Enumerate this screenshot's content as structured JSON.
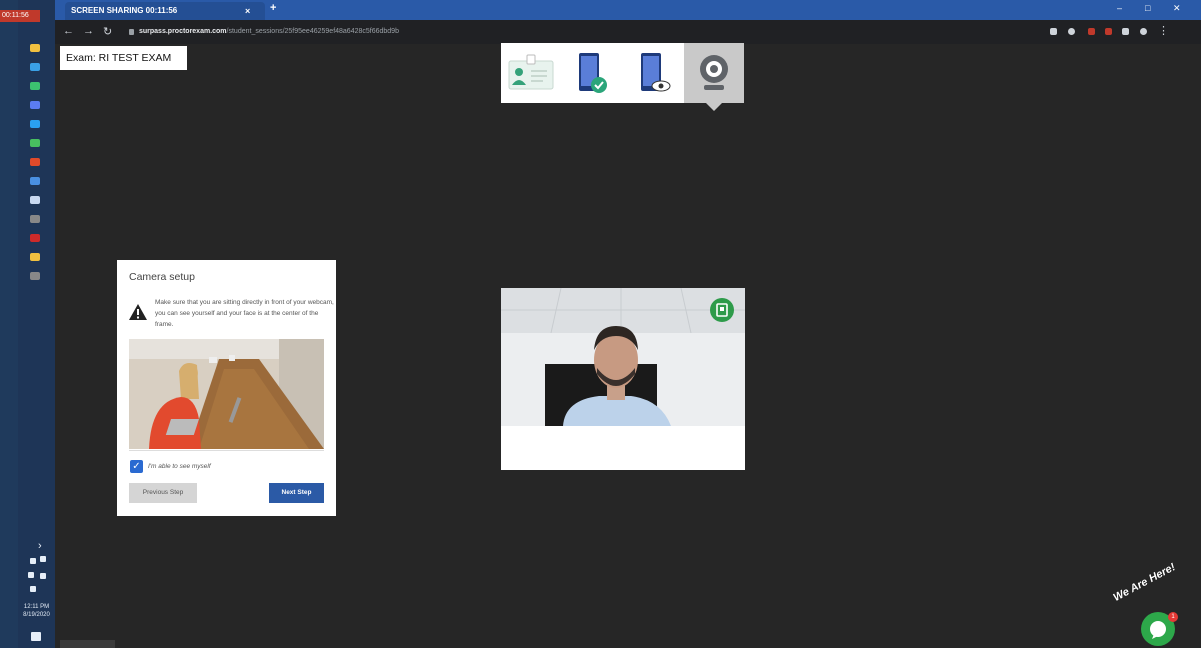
{
  "taskbar": {
    "rec_badge": "00:11:56",
    "time": "12:11 PM",
    "date": "8/19/2020",
    "icon_colors": [
      "#f0c040",
      "#3aa0e6",
      "#3cc070",
      "#5b7cf0",
      "#2aa0f0",
      "#48c060",
      "#e04a2a",
      "#4a90e2",
      "#c8d8f0",
      "#888888",
      "#cc2a2a",
      "#f0c040",
      "#888888"
    ]
  },
  "browser": {
    "tab_title": "SCREEN SHARING  00:11:56",
    "url_host": "surpass.proctorexam.com",
    "url_path": "/student_sessions/25f95ee46259ef48a6428c5f66dbd9b",
    "close_glyph": "×",
    "new_tab_glyph": "+",
    "minimize_glyph": "–",
    "maximize_glyph": "□",
    "window_close_glyph": "✕"
  },
  "exam": {
    "label": "Exam: RI TEST EXAM"
  },
  "steps": [
    {
      "icon": "id-card-icon",
      "active": false
    },
    {
      "icon": "phone-check-icon",
      "active": false
    },
    {
      "icon": "phone-eye-icon",
      "active": false
    },
    {
      "icon": "webcam-icon",
      "active": true
    }
  ],
  "camera_setup": {
    "title": "Camera setup",
    "instructions": "Make sure that you are sitting directly in front of your webcam, you can see yourself and your face is at the center of the frame.",
    "checkbox_label": "I'm able to see myself",
    "checkbox_checked": true,
    "prev_button": "Previous Step",
    "next_button": "Next Step"
  },
  "chat_widget": {
    "label": "We Are Here!",
    "badge_count": "1"
  },
  "colors": {
    "background": "#262626",
    "accent": "#2b5aa6",
    "success": "#2e9b4a"
  }
}
